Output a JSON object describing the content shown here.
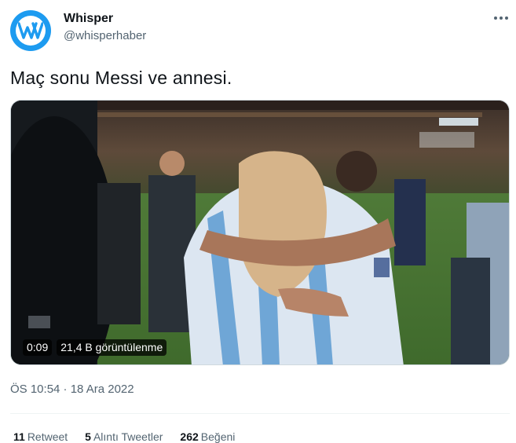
{
  "author": {
    "name": "Whisper",
    "handle": "@whisperhaber",
    "avatar_color": "#1d9bf0"
  },
  "tweet": {
    "text": "Maç sonu Messi ve annesi.",
    "timestamp": "ÖS 10:54 · 18 Ara 2022"
  },
  "video": {
    "duration": "0:09",
    "views": "21,4 B görüntülenme"
  },
  "stats": {
    "retweets_count": "11",
    "retweets_label": "Retweet",
    "quotes_count": "5",
    "quotes_label": "Alıntı Tweetler",
    "likes_count": "262",
    "likes_label": "Beğeni"
  },
  "icons": {
    "more": "more-dots-icon",
    "logo": "whisper-logo-icon"
  }
}
